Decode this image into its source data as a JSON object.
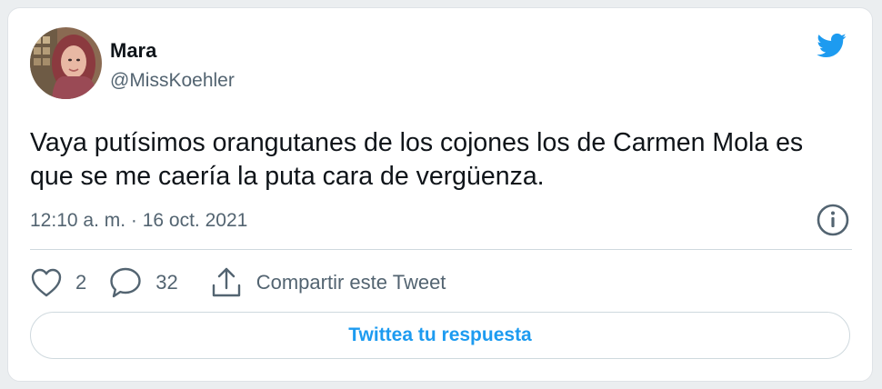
{
  "tweet": {
    "author": {
      "name": "Mara",
      "handle": "@MissKoehler"
    },
    "text": "Vaya putísimos orangutanes de los cojones los de Carmen Mola es que se me caería la puta cara de vergüenza.",
    "timestamp": "12:10 a. m. · 16 oct. 2021"
  },
  "actions": {
    "like_count": "2",
    "reply_count": "32",
    "share_label": "Compartir este Tweet"
  },
  "reply_button_label": "Twittea tu respuesta",
  "icons": {
    "brand": "twitter-bird-icon",
    "info": "info-icon",
    "like": "heart-icon",
    "reply": "reply-bubble-icon",
    "share": "share-icon"
  },
  "colors": {
    "accent": "#1d9bf0",
    "text_primary": "#0f1419",
    "text_secondary": "#536471"
  }
}
